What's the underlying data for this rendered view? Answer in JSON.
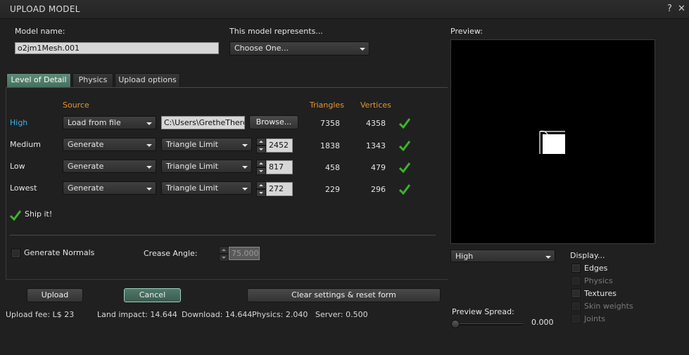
{
  "window": {
    "title": "UPLOAD MODEL",
    "help_icon": "help-icon",
    "close_icon": "close-icon"
  },
  "model_name": {
    "label": "Model name:",
    "value": "o2jm1Mesh.001"
  },
  "represents": {
    "label": "This model represents...",
    "value": "Choose One..."
  },
  "tabs": [
    {
      "label": "Level of Detail",
      "active": true
    },
    {
      "label": "Physics"
    },
    {
      "label": "Upload options"
    }
  ],
  "lod": {
    "headers": {
      "source": "Source",
      "triangles": "Triangles",
      "vertices": "Vertices"
    },
    "rows": [
      {
        "name": "High",
        "source": "Load from file",
        "file_path": "C:\\Users\\GretheThere",
        "browse": "Browse...",
        "triangles": "7358",
        "vertices": "4358",
        "highlight": true
      },
      {
        "name": "Medium",
        "source": "Generate",
        "mode": "Triangle Limit",
        "limit": "2452",
        "triangles": "1838",
        "vertices": "1343"
      },
      {
        "name": "Low",
        "source": "Generate",
        "mode": "Triangle Limit",
        "limit": "817",
        "triangles": "458",
        "vertices": "479"
      },
      {
        "name": "Lowest",
        "source": "Generate",
        "mode": "Triangle Limit",
        "limit": "272",
        "triangles": "229",
        "vertices": "296"
      }
    ],
    "ship_it": "Ship it!"
  },
  "normals": {
    "label": "Generate Normals",
    "checked": false,
    "crease_label": "Crease Angle:",
    "crease_value": "75.000"
  },
  "buttons": {
    "upload": "Upload",
    "cancel": "Cancel",
    "reset": "Clear settings & reset form"
  },
  "status": {
    "fee": "Upload fee: L$ 23",
    "land_impact": "Land impact: 14.644",
    "download": "Download: 14.644",
    "physics": "Physics: 2.040",
    "server": "Server: 0.500"
  },
  "preview": {
    "label": "Preview:",
    "lod_select": "High",
    "display_label": "Display...",
    "display_options": [
      {
        "label": "Edges",
        "enabled": true
      },
      {
        "label": "Physics",
        "enabled": false
      },
      {
        "label": "Textures",
        "enabled": true
      },
      {
        "label": "Skin weights",
        "enabled": false
      },
      {
        "label": "Joints",
        "enabled": false
      }
    ],
    "spread_label": "Preview Spread:",
    "spread_value": "0.000"
  },
  "colors": {
    "accent_orange": "#e6962e",
    "accent_blue": "#3fb3ea",
    "check_green": "#39b52a"
  }
}
